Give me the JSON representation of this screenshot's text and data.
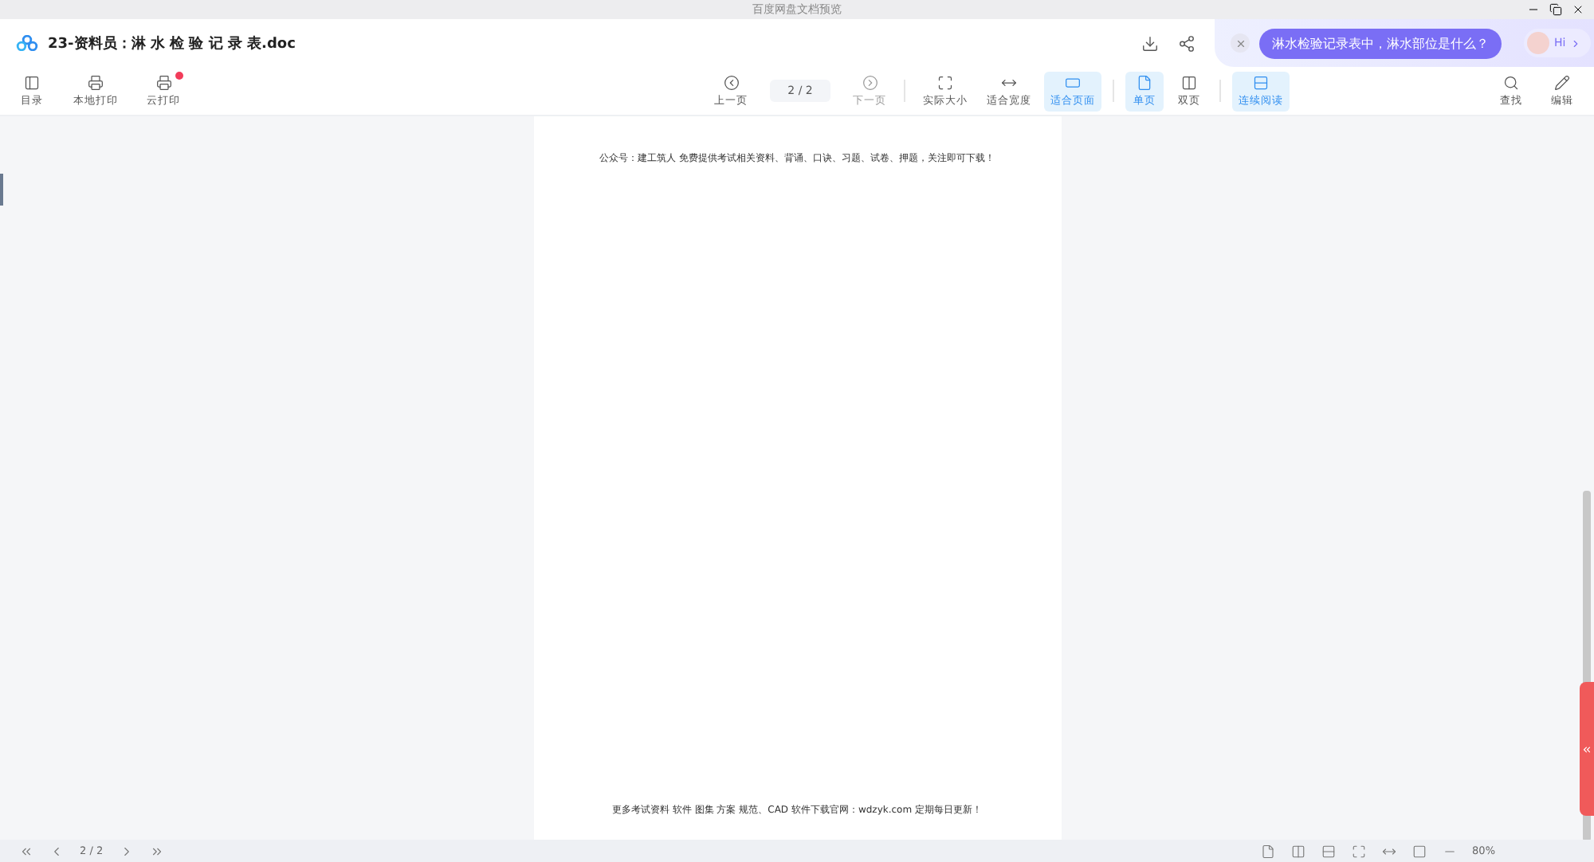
{
  "window": {
    "title": "百度网盘文档预览"
  },
  "header": {
    "file_name": "23-资料员：淋 水 检 验 记 录 表.doc",
    "assistant": {
      "question": "淋水检验记录表中，淋水部位是什么？",
      "greeting": "Hi"
    }
  },
  "toolbar_left": [
    {
      "kind": "toc",
      "label": "目录",
      "badge": false
    },
    {
      "kind": "print",
      "label": "本地打印",
      "badge": false
    },
    {
      "kind": "cloud",
      "label": "云打印",
      "badge": true
    }
  ],
  "toolbar_center": [
    {
      "kind": "prev",
      "label": "上一页",
      "selected": false,
      "disabled": false
    },
    {
      "kind": "page",
      "label": "2 / 2"
    },
    {
      "kind": "next",
      "label": "下一页",
      "selected": false,
      "disabled": true
    },
    {
      "kind": "sep"
    },
    {
      "kind": "actual",
      "label": "实际大小",
      "selected": false,
      "disabled": false
    },
    {
      "kind": "width",
      "label": "适合宽度",
      "selected": false,
      "disabled": false
    },
    {
      "kind": "fitpage",
      "label": "适合页面",
      "selected": true,
      "disabled": false
    },
    {
      "kind": "sep"
    },
    {
      "kind": "single",
      "label": "单页",
      "selected": true,
      "disabled": false
    },
    {
      "kind": "double",
      "label": "双页",
      "selected": false,
      "disabled": false
    },
    {
      "kind": "sep"
    },
    {
      "kind": "continuous",
      "label": "连续阅读",
      "selected": true,
      "disabled": false
    }
  ],
  "toolbar_right": [
    {
      "kind": "search",
      "label": "查找"
    },
    {
      "kind": "edit",
      "label": "编辑"
    }
  ],
  "document": {
    "header_text": "公众号：建工筑人 免费提供考试相关资料、背诵、口诀、习题、试卷、押题，关注即可下载！",
    "footer_text": "更多考试资料 软件 图集 方案 规范、CAD 软件下载官网：wdzyk.com 定期每日更新！"
  },
  "bottom_bar": {
    "page": "2 / 2",
    "zoom": "80%"
  }
}
